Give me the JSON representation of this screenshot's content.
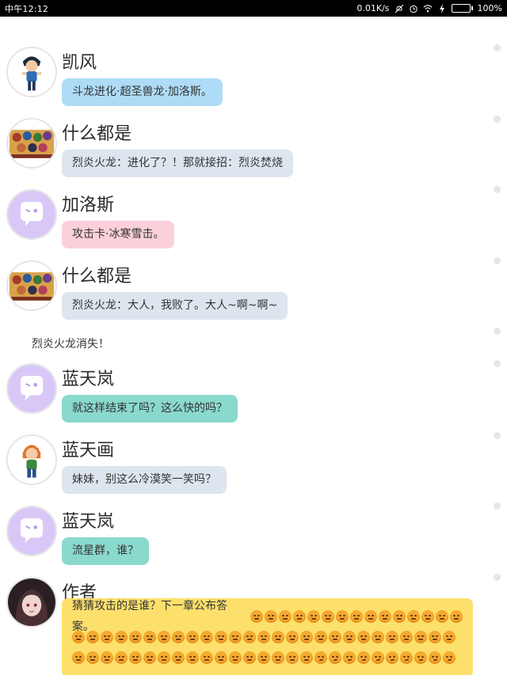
{
  "status_bar": {
    "time": "中午12:12",
    "network_speed": "0.01K/s",
    "battery_percent": "100%",
    "battery_level": 1.0,
    "icons": [
      "mute-icon",
      "alarm-icon",
      "wifi-icon",
      "charging-icon"
    ]
  },
  "messages": [
    {
      "sender": "凯风",
      "text": "斗龙进化·超圣兽龙·加洛斯。",
      "color": "#aedcf7",
      "avatar": "boy-character-avatar"
    },
    {
      "sender": "什么都是",
      "text": "烈炎火龙：进化了？！那就接招：烈炎焚烧",
      "color": "#dde5ee",
      "avatar": "group-poster-avatar"
    },
    {
      "sender": "加洛斯",
      "text": "攻击卡·冰寒雪击。",
      "color": "#fbd0da",
      "avatar": "default-chat-avatar"
    },
    {
      "sender": "什么都是",
      "text": "烈炎火龙：大人，我败了。大人~啊~啊~",
      "color": "#dde5ee",
      "avatar": "group-poster-avatar"
    },
    {
      "sender": "蓝天岚",
      "text": "就这样结束了吗？这么快的吗？",
      "color": "#8ad9cd",
      "avatar": "default-chat-avatar"
    },
    {
      "sender": "蓝天画",
      "text": "妹妹，别这么冷漠笑一笑吗？",
      "color": "#dde5ee",
      "avatar": "girl-character-avatar"
    },
    {
      "sender": "蓝天岚",
      "text": "流星群，谁？",
      "color": "#8ad9cd",
      "avatar": "default-chat-avatar"
    }
  ],
  "narration": "烈炎火龙消失！",
  "author_message": {
    "sender": "作者",
    "text": "猜猜攻击的是谁？下一章公布答案。",
    "color": "#fde06c",
    "avatar": "anime-girl-avatar",
    "emoji_name": "grimace-emoji"
  }
}
